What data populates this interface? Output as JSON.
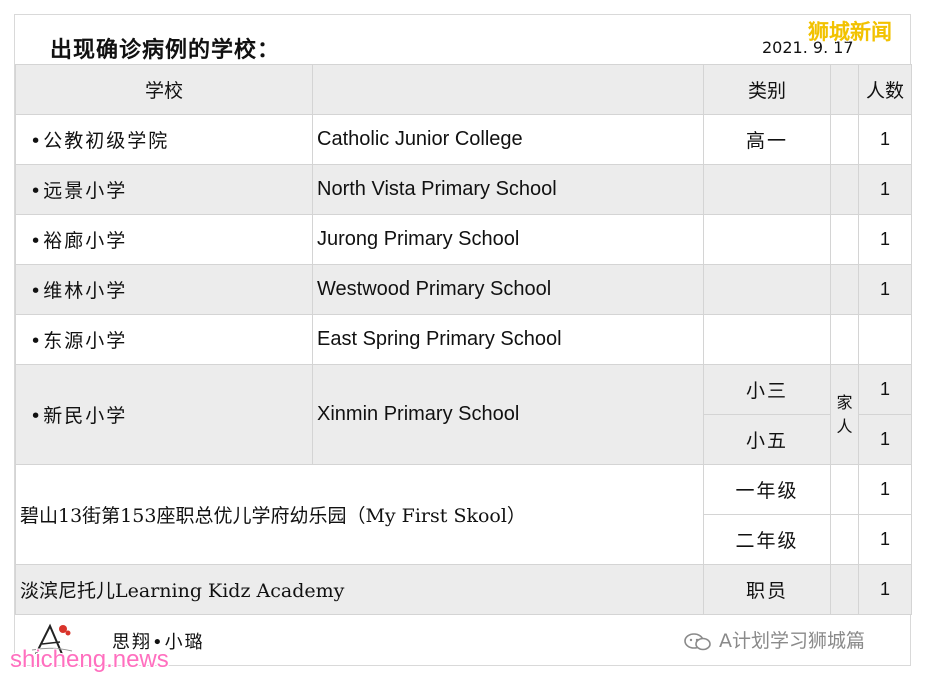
{
  "title": "出现确诊病例的学校：",
  "date": "2021. 9. 17",
  "watermark_top": "狮城新闻",
  "headers": {
    "school": "学校",
    "category": "类别",
    "count": "人数"
  },
  "rows": [
    {
      "cn": "•公教初级学院",
      "en": "Catholic Junior College",
      "category": "高一",
      "count": "1"
    },
    {
      "cn": "•远景小学",
      "en": "North Vista Primary School",
      "category": "",
      "count": "1"
    },
    {
      "cn": "•裕廊小学",
      "en": "Jurong Primary School",
      "category": "",
      "count": "1"
    },
    {
      "cn": "•维林小学",
      "en": "Westwood Primary School",
      "category": "",
      "count": "1"
    },
    {
      "cn": "•东源小学",
      "en": "East Spring Primary School",
      "category": "",
      "count": ""
    }
  ],
  "xinmin": {
    "cn": "•新民小学",
    "en": "Xinmin Primary School",
    "note": "家人",
    "sub": [
      {
        "category": "小三",
        "count": "1"
      },
      {
        "category": "小五",
        "count": "1"
      }
    ]
  },
  "bishan": {
    "name": "碧山13街第153座职总优儿学府幼乐园（My First Skool）",
    "sub": [
      {
        "category": "一年级",
        "count": "1"
      },
      {
        "category": "二年级",
        "count": "1"
      }
    ]
  },
  "learning_kidz": {
    "name": "淡滨尼托儿Learning Kidz Academy",
    "category": "职员",
    "count": "1"
  },
  "footer": {
    "author": "思翔•小璐",
    "account": "A计划学习狮城篇",
    "wechat_icon": "wechat-icon"
  },
  "watermark_bottom": "shicheng.news",
  "colors": {
    "row_gray": "#ececec",
    "watermark_yellow": "#f2c200",
    "watermark_pink": "#ff6fbf"
  }
}
